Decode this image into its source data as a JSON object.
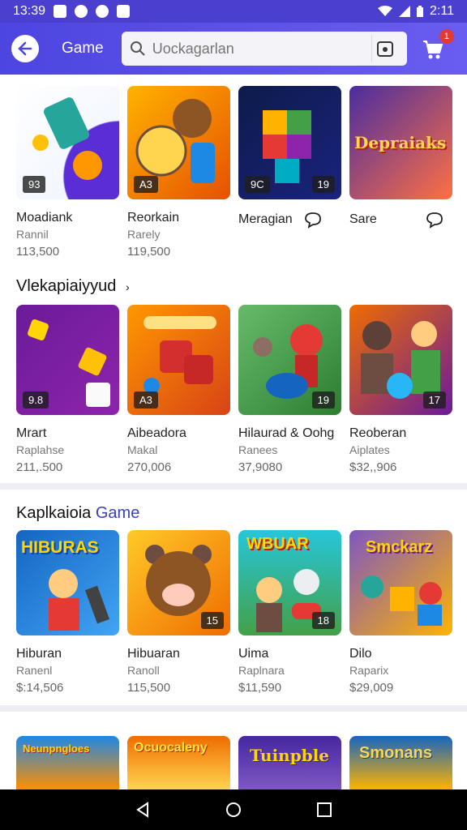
{
  "status": {
    "time": "13:39",
    "battery_time": "2:11"
  },
  "header": {
    "title": "Game",
    "search_placeholder": "Uockagarlan",
    "cart_count": "1"
  },
  "rows": [
    {
      "items": [
        {
          "title": "Moadiank",
          "sub": "Rannil",
          "price": "113,500",
          "tag": "93",
          "colors": [
            "#ffffff",
            "#5b2dd6"
          ]
        },
        {
          "title": "Reorkain",
          "sub": "Rarely",
          "price": "119,500",
          "tag": "A3",
          "colors": [
            "#ffb300",
            "#e65100"
          ]
        },
        {
          "title": "Meragian",
          "sub": "",
          "price": "",
          "tag": "9C",
          "tag_r": "19",
          "colors": [
            "#1a237e",
            "#00897b"
          ]
        },
        {
          "title": "Sare",
          "sub": "",
          "price": "",
          "tag": "",
          "colors": [
            "#4a2ca0",
            "#ff7043"
          ],
          "thumb_text": "Depraiaks"
        }
      ]
    },
    {
      "section": "Vlekapiaiyyud",
      "items": [
        {
          "title": "Mrart",
          "sub": "Raplahse",
          "price": "211,.500",
          "tag": "9.8",
          "colors": [
            "#6a1b9a",
            "#8e24aa"
          ]
        },
        {
          "title": "Aibeadora",
          "sub": "Makal",
          "price": "270,006",
          "tag": "A3",
          "colors": [
            "#ff9800",
            "#c62828"
          ]
        },
        {
          "title": "Hilaurad & Oohg",
          "sub": "Ranees",
          "price": "37,9080",
          "tag_r": "19",
          "colors": [
            "#43a047",
            "#e53935"
          ]
        },
        {
          "title": "Reoberan",
          "sub": "Aiplates",
          "price": "$32,,906",
          "tag_r": "17",
          "colors": [
            "#2e7d32",
            "#ffa000"
          ]
        }
      ]
    },
    {
      "section": "Kaplkaioia",
      "section_accent": "Game",
      "items": [
        {
          "title": "Hiburan",
          "sub": "Ranenl",
          "price": "$:14,506",
          "tag": "",
          "colors": [
            "#1565c0",
            "#42a5f5"
          ],
          "thumb_text": "HIBURAS"
        },
        {
          "title": "Hibuaran",
          "sub": "Ranoll",
          "price": "115,500",
          "tag_r": "15",
          "colors": [
            "#ffca28",
            "#ef6c00"
          ]
        },
        {
          "title": "Uima",
          "sub": "Raplnara",
          "price": "$11,590",
          "tag_r": "18",
          "colors": [
            "#26a69a",
            "#e91e63"
          ],
          "thumb_text": "WBUAR"
        },
        {
          "title": "Dilo",
          "sub": "Raparix",
          "price": "$29,009",
          "tag": "",
          "colors": [
            "#7e57c2",
            "#ffb300"
          ],
          "thumb_text": "Smckarz"
        }
      ]
    },
    {
      "items": [
        {
          "thumb_text": "Neunpngloes",
          "colors": [
            "#1e88e5",
            "#ff8f00"
          ]
        },
        {
          "thumb_text": "Ocuocaleny",
          "colors": [
            "#ef6c00",
            "#ffd54f"
          ]
        },
        {
          "thumb_text": "Tuinpble",
          "colors": [
            "#4527a0",
            "#7e57c2"
          ]
        },
        {
          "thumb_text": "Smonans",
          "colors": [
            "#1565c0",
            "#ffb300"
          ]
        }
      ]
    }
  ]
}
